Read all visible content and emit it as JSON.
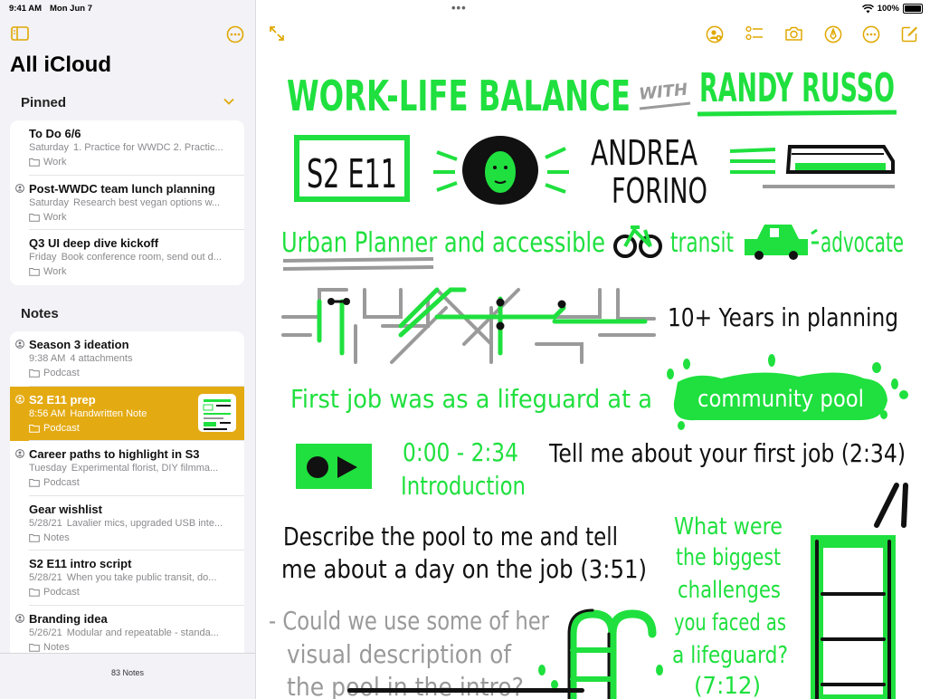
{
  "status": {
    "time": "9:41 AM",
    "date": "Mon Jun 7",
    "battery": "100%"
  },
  "sidebar": {
    "title": "All iCloud",
    "pinned_title": "Pinned",
    "notes_title": "Notes",
    "count": "83 Notes",
    "pinned": [
      {
        "title": "To Do 6/6",
        "date": "Saturday",
        "preview": "1. Practice for WWDC 2. Practic...",
        "folder": "Work",
        "shared": false
      },
      {
        "title": "Post-WWDC team lunch planning",
        "date": "Saturday",
        "preview": "Research best vegan options w...",
        "folder": "Work",
        "shared": true
      },
      {
        "title": "Q3 UI deep dive kickoff",
        "date": "Friday",
        "preview": "Book conference room, send out d...",
        "folder": "Work",
        "shared": false
      }
    ],
    "notes": [
      {
        "title": "Season 3 ideation",
        "date": "9:38 AM",
        "preview": "4 attachments",
        "folder": "Podcast",
        "shared": true
      },
      {
        "title": "S2 E11 prep",
        "date": "8:56 AM",
        "preview": "Handwritten Note",
        "folder": "Podcast",
        "shared": true,
        "selected": true
      },
      {
        "title": "Career paths to highlight in S3",
        "date": "Tuesday",
        "preview": "Experimental florist, DIY filmma...",
        "folder": "Podcast",
        "shared": true
      },
      {
        "title": "Gear wishlist",
        "date": "5/28/21",
        "preview": "Lavalier mics, upgraded USB inte...",
        "folder": "Notes",
        "shared": false
      },
      {
        "title": "S2 E11 intro script",
        "date": "5/28/21",
        "preview": "When you take public transit, do...",
        "folder": "Podcast",
        "shared": false
      },
      {
        "title": "Branding idea",
        "date": "5/26/21",
        "preview": "Modular and repeatable - standa...",
        "folder": "Notes",
        "shared": true
      }
    ]
  },
  "note": {
    "title_a": "WORK-LIFE BALANCE",
    "title_with": "WITH",
    "title_b": "RANDY RUSSO",
    "episode": "S2 E11",
    "guest_1": "ANDREA",
    "guest_2": "FORINO",
    "role_1": "Urban Planner and accessible",
    "role_2": "transit",
    "role_3": "advocate",
    "years": "10+ Years in planning",
    "job_1": "First job was as a lifeguard at a",
    "pool": "community pool",
    "time_1": "0:00 - 2:34",
    "intro": "Introduction",
    "q1": "Tell me about your first job (2:34)",
    "q2a": "Describe the pool to me and tell",
    "q2b": "me about a day on the job (3:51)",
    "q3a": "What were",
    "q3b": "the biggest",
    "q3c": "challenges",
    "q3d": "you faced as",
    "q3e": "a lifeguard?",
    "q3f": "(7:12)",
    "c1": "- Could we use some of her",
    "c2": "visual description of",
    "c3": "the pool in the intro?"
  },
  "colors": {
    "accent": "#e4aa12",
    "ink_green": "#1fe03e",
    "ink_black": "#111111",
    "ink_gray": "#9a9a9a"
  }
}
